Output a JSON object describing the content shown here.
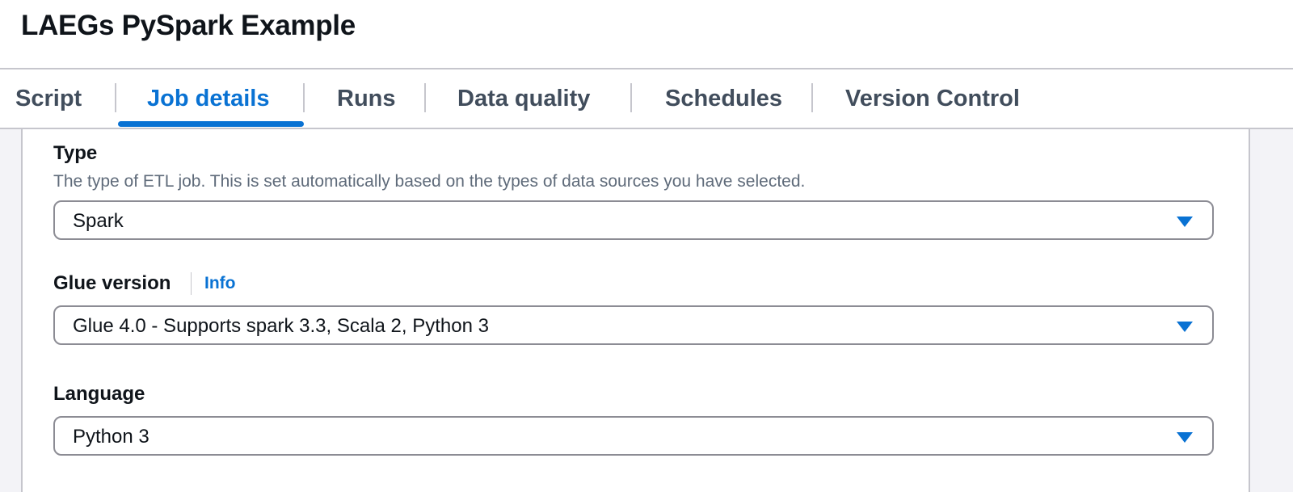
{
  "header": {
    "title": "LAEGs PySpark Example"
  },
  "tabs": [
    {
      "label": "Script",
      "active": false
    },
    {
      "label": "Job details",
      "active": true
    },
    {
      "label": "Runs",
      "active": false
    },
    {
      "label": "Data quality",
      "active": false
    },
    {
      "label": "Schedules",
      "active": false
    },
    {
      "label": "Version Control",
      "active": false
    }
  ],
  "form": {
    "type": {
      "label": "Type",
      "description": "The type of ETL job. This is set automatically based on the types of data sources you have selected.",
      "value": "Spark"
    },
    "glue_version": {
      "label": "Glue version",
      "info_link": "Info",
      "value": "Glue 4.0 - Supports spark 3.3, Scala 2, Python 3"
    },
    "language": {
      "label": "Language",
      "value": "Python 3"
    }
  },
  "colors": {
    "accent": "#0972d3",
    "text": "#0f141a",
    "secondary_text": "#5f6b7a",
    "border": "#8c8c94"
  },
  "icons": {
    "select_caret": "caret-down-icon"
  }
}
